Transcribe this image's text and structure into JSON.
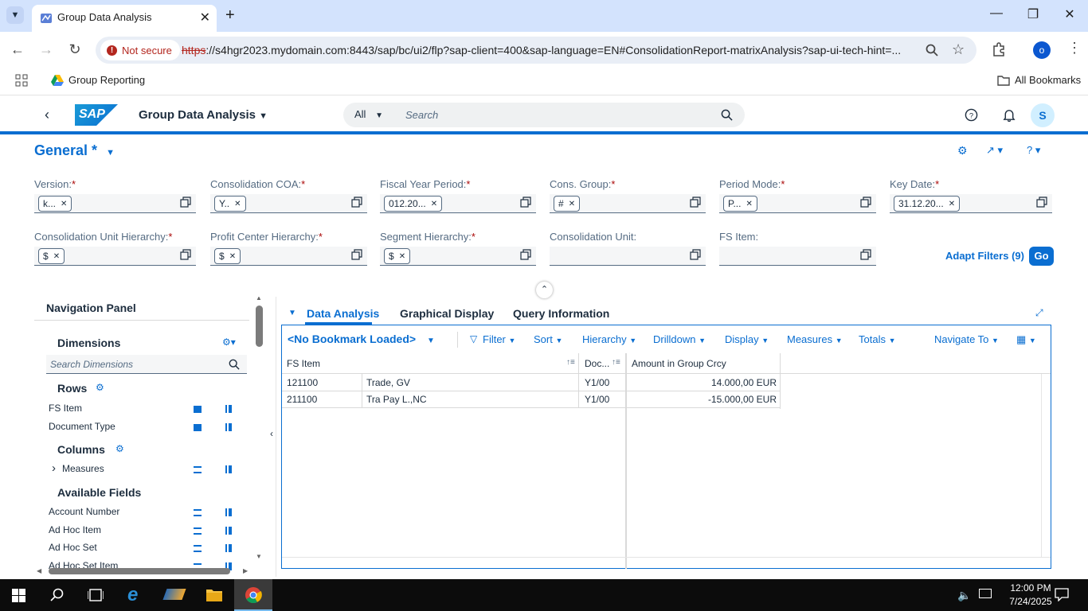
{
  "browser": {
    "tab_title": "Group Data Analysis",
    "not_secure": "Not secure",
    "url_https": "https",
    "url_rest": "://s4hgr2023.mydomain.com:8443/sap/bc/ui2/flp?sap-client=400&sap-language=EN#ConsolidationReport-matrixAnalysis?sap-ui-tech-hint=...",
    "bookmark_group_reporting": "Group Reporting",
    "all_bookmarks": "All Bookmarks",
    "profile_initial": "o"
  },
  "shell": {
    "title": "Group Data Analysis",
    "search_scope": "All",
    "search_placeholder": "Search",
    "user_initial": "S",
    "logo_text": "SAP"
  },
  "filterbar": {
    "variant": "General *",
    "fields": [
      {
        "label": "Version:",
        "token": "k..."
      },
      {
        "label": "Consolidation COA:",
        "token": "Y.."
      },
      {
        "label": "Fiscal Year Period:",
        "token": "012.20..."
      },
      {
        "label": "Cons. Group:",
        "token": "#"
      },
      {
        "label": "Period Mode:",
        "token": "P..."
      },
      {
        "label": "Key Date:",
        "token": "31.12.20..."
      },
      {
        "label": "Consolidation Unit Hierarchy:",
        "token": "$"
      },
      {
        "label": "Profit Center Hierarchy:",
        "token": "$"
      },
      {
        "label": "Segment Hierarchy:",
        "token": "$"
      },
      {
        "label": "Consolidation Unit:",
        "token": ""
      },
      {
        "label": "FS Item:",
        "token": ""
      }
    ],
    "required_mark": "*",
    "adapt_filters": "Adapt Filters (9)",
    "go": "Go"
  },
  "nav_panel": {
    "title": "Navigation Panel",
    "dimensions": "Dimensions",
    "search_placeholder": "Search Dimensions",
    "rows_title": "Rows",
    "rows": [
      "FS Item",
      "Document Type"
    ],
    "columns_title": "Columns",
    "columns": [
      "Measures"
    ],
    "available_title": "Available Fields",
    "available": [
      "Account Number",
      "Ad Hoc Item",
      "Ad Hoc Set",
      "Ad Hoc Set Item"
    ]
  },
  "content": {
    "tabs": [
      "Data Analysis",
      "Graphical Display",
      "Query Information"
    ],
    "bookmark": "<No Bookmark Loaded>",
    "toolbar": [
      "Filter",
      "Sort",
      "Hierarchy",
      "Drilldown",
      "Display",
      "Measures",
      "Totals",
      "Navigate To"
    ],
    "grid": {
      "headers": [
        "FS Item",
        "Doc...",
        "Amount in Group Crcy"
      ],
      "rows": [
        {
          "code": "121100",
          "text": "Trade, GV",
          "doc": "Y1/00",
          "amount": "14.000,00 EUR"
        },
        {
          "code": "211100",
          "text": "Tra Pay L.,NC",
          "doc": "Y1/00",
          "amount": "-15.000,00 EUR"
        }
      ]
    }
  },
  "taskbar": {
    "time": "12:00 PM",
    "date": "7/24/2025"
  },
  "colors": {
    "accent": "#0a6ed1",
    "chrome_tabstrip": "#d3e3fd",
    "taskbar": "#0c0c0c"
  }
}
